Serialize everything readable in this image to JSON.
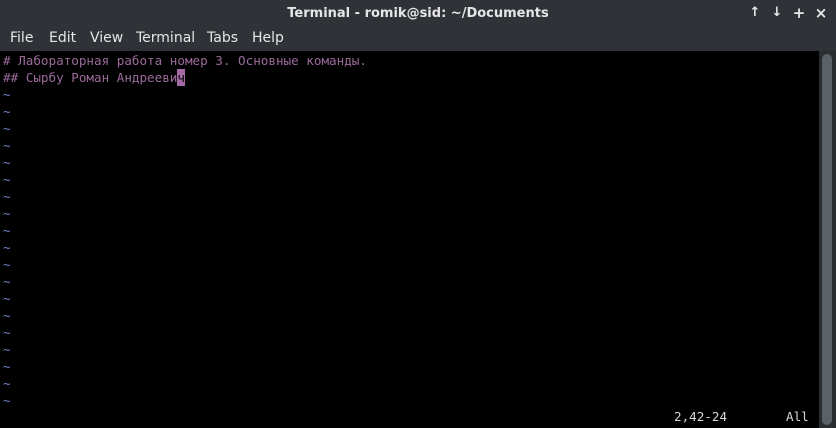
{
  "window": {
    "title": "Terminal - romik@sid: ~/Documents",
    "controls": {
      "up": "↑",
      "down": "↓",
      "maximize": "+",
      "close": "×"
    }
  },
  "menubar": {
    "items": [
      "File",
      "Edit",
      "View",
      "Terminal",
      "Tabs",
      "Help"
    ]
  },
  "editor": {
    "lines": [
      "# Лабораторная работа номер 3. Основные команды.",
      "## Сырбу Роман Андрееви"
    ],
    "cursor_char": "ч",
    "empty_line_marker": "~",
    "empty_line_count": 19,
    "colors": {
      "comment": "#9a6b9a",
      "tilde": "#6f86c6",
      "cursor": "#a56aa5"
    }
  },
  "statusline": {
    "position": "2,42-24",
    "scroll": "All"
  }
}
